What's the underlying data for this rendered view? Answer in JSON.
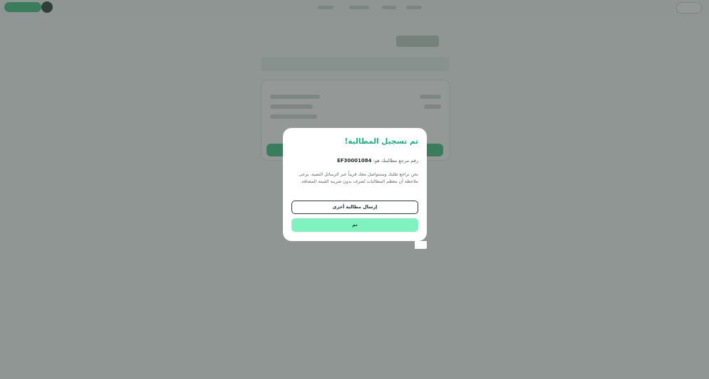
{
  "modal": {
    "title": "تم تسجيل المطالبة!",
    "reference_label": "رقم مرجع مطالبتك هو:",
    "reference_number": "EF30001084",
    "message": "نحن نراجع طلبك وسنتواصل معك قريباً عبر الرسائل النصية. يرجى ملاحظة أن معظم المطالبات تُصرف بدون ضريبة القيمة المضافة.",
    "secondary_button": "إرسال مطالبة أخرى",
    "primary_button": "تم"
  },
  "colors": {
    "accent": "#14b37a",
    "primary_button_bg": "#7ff2bf",
    "overlay": "rgba(60,70,66,0.55)"
  }
}
